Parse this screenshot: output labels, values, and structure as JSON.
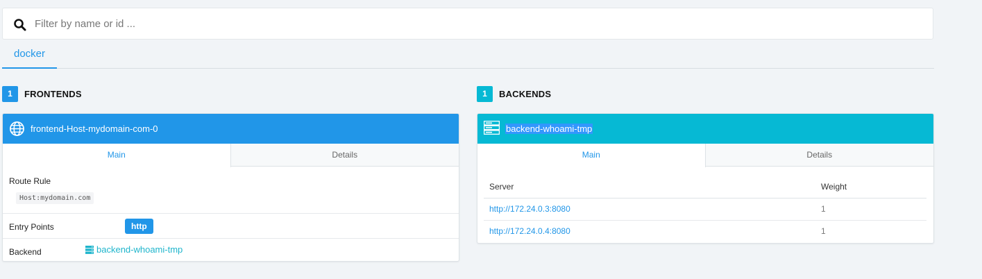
{
  "colors": {
    "frontend_accent": "#2196e8",
    "backend_accent": "#06b9d4",
    "link_teal": "#1fb5cc"
  },
  "search": {
    "placeholder": "Filter by name or id ...",
    "value": ""
  },
  "provider_tabs": [
    {
      "label": "docker",
      "active": true
    }
  ],
  "frontends": {
    "count": "1",
    "title": "FRONTENDS",
    "items": [
      {
        "name": "frontend-Host-mydomain-com-0",
        "icon": "globe-icon",
        "tabs": [
          "Main",
          "Details"
        ],
        "route_rule_label": "Route Rule",
        "route_rule_value": "Host:mydomain.com",
        "entry_points_label": "Entry Points",
        "entry_points": [
          "http"
        ],
        "backend_label": "Backend",
        "backend_value": "backend-whoami-tmp",
        "backend_icon": "server-icon"
      }
    ]
  },
  "backends": {
    "count": "1",
    "title": "BACKENDS",
    "items": [
      {
        "name": "backend-whoami-tmp",
        "icon": "server-icon",
        "tabs": [
          "Main",
          "Details"
        ],
        "columns": [
          "Server",
          "Weight"
        ],
        "servers": [
          {
            "url": "http://172.24.0.3:8080",
            "weight": "1"
          },
          {
            "url": "http://172.24.0.4:8080",
            "weight": "1"
          }
        ]
      }
    ]
  }
}
